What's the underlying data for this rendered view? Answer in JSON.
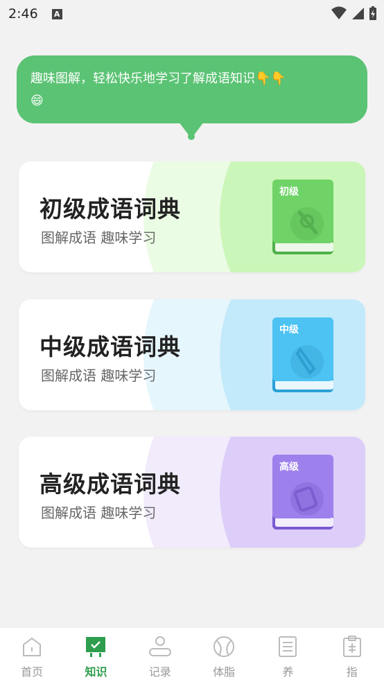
{
  "status": {
    "time": "2:46",
    "notification_icon": "A"
  },
  "bubble": {
    "text": "趣味图解，轻松快乐地学习了解成语知识",
    "emojis": [
      "👇",
      "👇",
      "😄"
    ]
  },
  "cards": [
    {
      "title": "初级成语词典",
      "subtitle": "图解成语 趣味学习",
      "book_label": "初级",
      "accent": "#c9f5b8",
      "book_color": "#69cf62"
    },
    {
      "title": "中级成语词典",
      "subtitle": "图解成语 趣味学习",
      "book_label": "中级",
      "accent": "#c3eafc",
      "book_color": "#45bff0"
    },
    {
      "title": "高级成语词典",
      "subtitle": "图解成语 趣味学习",
      "book_label": "高级",
      "accent": "#dcccf9",
      "book_color": "#9b7be8"
    }
  ],
  "tabs": [
    {
      "label": "首页",
      "icon": "home-icon",
      "active": false
    },
    {
      "label": "知识",
      "icon": "knowledge-icon",
      "active": true
    },
    {
      "label": "记录",
      "icon": "profile-icon",
      "active": false
    },
    {
      "label": "体脂",
      "icon": "ball-icon",
      "active": false
    },
    {
      "label": "养",
      "icon": "list-icon",
      "active": false
    },
    {
      "label": "指",
      "icon": "clipboard-icon",
      "active": false
    }
  ]
}
